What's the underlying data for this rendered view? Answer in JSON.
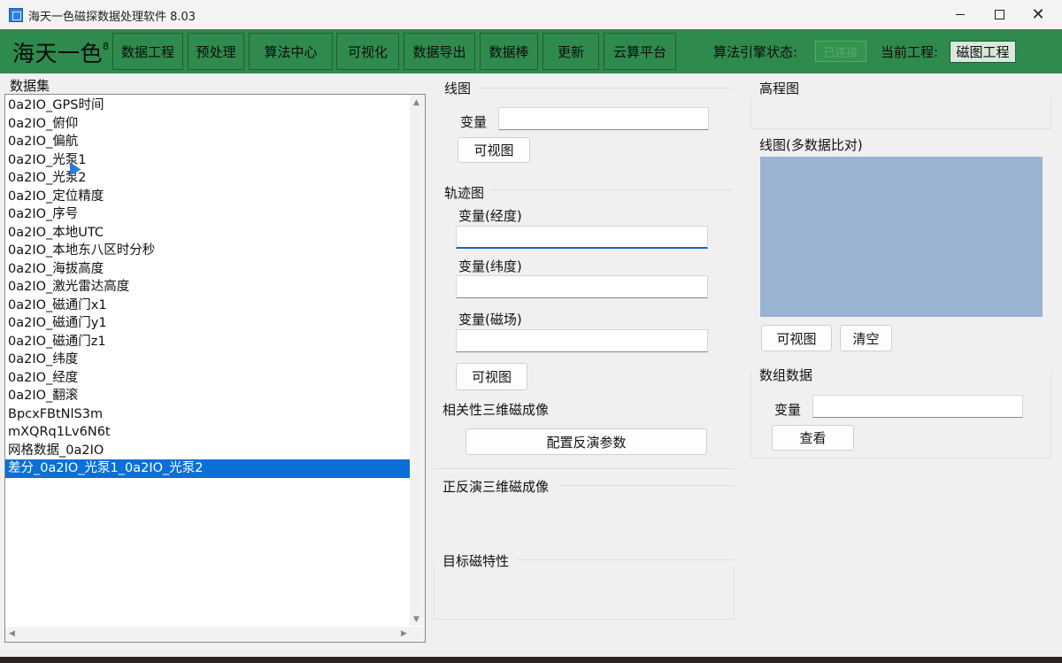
{
  "window": {
    "title": "海天一色磁探数据处理软件 8.03",
    "icon": "app-grid-icon"
  },
  "toolbar": {
    "brand": "海天一色",
    "brand_sup": "8",
    "menu": [
      "数据工程",
      "预处理",
      "算法中心",
      "可视化",
      "数据导出",
      "数据棒",
      "更新",
      "云算平台"
    ],
    "engine_label": "算法引擎状态:",
    "engine_status": "已连接",
    "project_label": "当前工程:",
    "project_value": "磁图工程",
    "colors": {
      "bar": "#2f8a4e"
    }
  },
  "dataset": {
    "title": "数据集",
    "items": [
      "0a2IO_GPS时间",
      "0a2IO_俯仰",
      "0a2IO_偏航",
      "0a2IO_光泵1",
      "0a2IO_光泵2",
      "0a2IO_定位精度",
      "0a2IO_序号",
      "0a2IO_本地UTC",
      "0a2IO_本地东八区时分秒",
      "0a2IO_海拔高度",
      "0a2IO_激光雷达高度",
      "0a2IO_磁通门x1",
      "0a2IO_磁通门y1",
      "0a2IO_磁通门z1",
      "0a2IO_纬度",
      "0a2IO_经度",
      "0a2IO_翻滚",
      "BpcxFBtNlS3m",
      "mXQRq1Lv6N6t",
      "网格数据_0a2IO",
      "差分_0a2IO_光泵1_0a2IO_光泵2"
    ],
    "selected_index": 20
  },
  "line_chart": {
    "title": "线图",
    "var_label": "变量",
    "var_value": "",
    "visualize": "可视图"
  },
  "trajectory": {
    "title": "轨迹图",
    "lon_label": "变量(经度)",
    "lat_label": "变量(纬度)",
    "mag_label": "变量(磁场)",
    "lon_value": "",
    "lat_value": "",
    "mag_value": "",
    "visualize": "可视图"
  },
  "correlation": {
    "title": "相关性三维磁成像",
    "config_button": "配置反演参数"
  },
  "forward_inverse": {
    "title": "正反演三维磁成像"
  },
  "target": {
    "title": "目标磁特性"
  },
  "elevation": {
    "title": "高程图"
  },
  "multi_line": {
    "title": "线图(多数据比对)",
    "visualize": "可视图",
    "clear": "清空",
    "plot_color": "#9ab3d3"
  },
  "array_data": {
    "title": "数组数据",
    "var_label": "变量",
    "var_value": "",
    "view": "查看"
  }
}
